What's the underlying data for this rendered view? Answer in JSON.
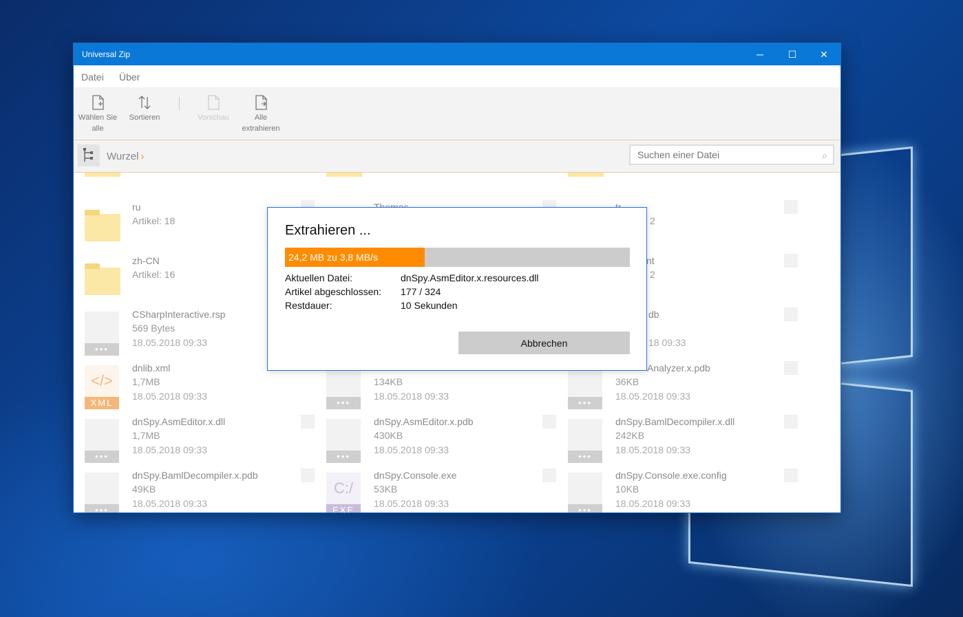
{
  "window": {
    "title": "Universal Zip",
    "controls": {
      "minimize": "─",
      "maximize": "☐",
      "close": "✕"
    }
  },
  "menu": {
    "items": [
      "Datei",
      "Über"
    ]
  },
  "ribbon": {
    "select_all": "Wählen Sie alle",
    "sort": "Sortieren",
    "preview": "Vorschau",
    "extract_all": "Alle extrahieren"
  },
  "path": {
    "root": "Wurzel",
    "chevron": "›"
  },
  "search": {
    "placeholder": "Suchen einer Datei",
    "icon": "search-icon"
  },
  "files": [
    {
      "name": "ru",
      "line2": "Artikel: 18",
      "line3": "",
      "kind": "folder"
    },
    {
      "name": "Themes",
      "line2": "",
      "line3": "",
      "kind": "folder"
    },
    {
      "name": "tr",
      "line2": "2",
      "line3": "",
      "kind": "folder"
    },
    {
      "name": "zh-CN",
      "line2": "Artikel: 16",
      "line3": "",
      "kind": "folder"
    },
    {
      "name": "",
      "line2": "",
      "line3": "",
      "kind": "none"
    },
    {
      "name": "nt",
      "line2": "2",
      "line3": "",
      "kind": "folder"
    },
    {
      "name": "CSharpInteractive.rsp",
      "line2": "569 Bytes",
      "line3": "18.05.2018 09:33",
      "kind": "doc"
    },
    {
      "name": "",
      "line2": "",
      "line3": "",
      "kind": "none"
    },
    {
      "name": "db",
      "line2": "",
      "line3": "18 09:33",
      "kind": "doc"
    },
    {
      "name": "dnlib.xml",
      "line2": "1,7MB",
      "line3": "18.05.2018 09:33",
      "kind": "xml"
    },
    {
      "name": "",
      "line2": "134KB",
      "line3": "18.05.2018 09:33",
      "kind": "doc"
    },
    {
      "name": "Analyzer.x.pdb",
      "line2": "36KB",
      "line3": "18.05.2018 09:33",
      "kind": "doc"
    },
    {
      "name": "dnSpy.AsmEditor.x.dll",
      "line2": "1,7MB",
      "line3": "18.05.2018 09:33",
      "kind": "doc"
    },
    {
      "name": "dnSpy.AsmEditor.x.pdb",
      "line2": "430KB",
      "line3": "18.05.2018 09:33",
      "kind": "doc"
    },
    {
      "name": "dnSpy.BamlDecompiler.x.dll",
      "line2": "242KB",
      "line3": "18.05.2018 09:33",
      "kind": "doc"
    },
    {
      "name": "dnSpy.BamlDecompiler.x.pdb",
      "line2": "49KB",
      "line3": "18.05.2018 09:33",
      "kind": "doc"
    },
    {
      "name": "dnSpy.Console.exe",
      "line2": "53KB",
      "line3": "18.05.2018 09:33",
      "kind": "exe"
    },
    {
      "name": "dnSpy.Console.exe.config",
      "line2": "10KB",
      "line3": "18.05.2018 09:33",
      "kind": "doc"
    }
  ],
  "badges": {
    "dots": "•••",
    "xml": "XML",
    "exe": "EXE",
    "xml_glyph": "</>",
    "exe_glyph": "C:/"
  },
  "dialog": {
    "title": "Extrahieren ...",
    "progress_text": "24,2 MB zu 3,8 MB/s",
    "progress_fraction": 0.405,
    "current_file_label": "Aktuellen Datei:",
    "current_file_value": "dnSpy.AsmEditor.x.resources.dll",
    "items_done_label": "Artikel abgeschlossen:",
    "items_done_value": "177 / 324",
    "remaining_label": "Restdauer:",
    "remaining_value": "10 Sekunden",
    "cancel_label": "Abbrechen"
  },
  "colors": {
    "accent": "#0a78d7",
    "progress": "#ff8c00",
    "folder": "#fbe7a6"
  }
}
